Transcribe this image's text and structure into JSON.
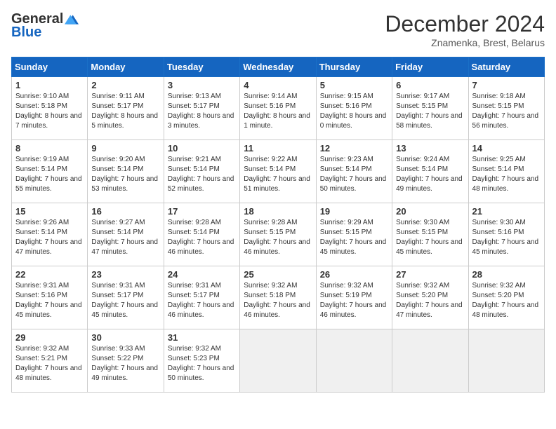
{
  "header": {
    "logo_general": "General",
    "logo_blue": "Blue",
    "month": "December 2024",
    "location": "Znamenka, Brest, Belarus"
  },
  "days_of_week": [
    "Sunday",
    "Monday",
    "Tuesday",
    "Wednesday",
    "Thursday",
    "Friday",
    "Saturday"
  ],
  "weeks": [
    [
      {
        "day": "1",
        "sunrise": "Sunrise: 9:10 AM",
        "sunset": "Sunset: 5:18 PM",
        "daylight": "Daylight: 8 hours and 7 minutes."
      },
      {
        "day": "2",
        "sunrise": "Sunrise: 9:11 AM",
        "sunset": "Sunset: 5:17 PM",
        "daylight": "Daylight: 8 hours and 5 minutes."
      },
      {
        "day": "3",
        "sunrise": "Sunrise: 9:13 AM",
        "sunset": "Sunset: 5:17 PM",
        "daylight": "Daylight: 8 hours and 3 minutes."
      },
      {
        "day": "4",
        "sunrise": "Sunrise: 9:14 AM",
        "sunset": "Sunset: 5:16 PM",
        "daylight": "Daylight: 8 hours and 1 minute."
      },
      {
        "day": "5",
        "sunrise": "Sunrise: 9:15 AM",
        "sunset": "Sunset: 5:16 PM",
        "daylight": "Daylight: 8 hours and 0 minutes."
      },
      {
        "day": "6",
        "sunrise": "Sunrise: 9:17 AM",
        "sunset": "Sunset: 5:15 PM",
        "daylight": "Daylight: 7 hours and 58 minutes."
      },
      {
        "day": "7",
        "sunrise": "Sunrise: 9:18 AM",
        "sunset": "Sunset: 5:15 PM",
        "daylight": "Daylight: 7 hours and 56 minutes."
      }
    ],
    [
      {
        "day": "8",
        "sunrise": "Sunrise: 9:19 AM",
        "sunset": "Sunset: 5:14 PM",
        "daylight": "Daylight: 7 hours and 55 minutes."
      },
      {
        "day": "9",
        "sunrise": "Sunrise: 9:20 AM",
        "sunset": "Sunset: 5:14 PM",
        "daylight": "Daylight: 7 hours and 53 minutes."
      },
      {
        "day": "10",
        "sunrise": "Sunrise: 9:21 AM",
        "sunset": "Sunset: 5:14 PM",
        "daylight": "Daylight: 7 hours and 52 minutes."
      },
      {
        "day": "11",
        "sunrise": "Sunrise: 9:22 AM",
        "sunset": "Sunset: 5:14 PM",
        "daylight": "Daylight: 7 hours and 51 minutes."
      },
      {
        "day": "12",
        "sunrise": "Sunrise: 9:23 AM",
        "sunset": "Sunset: 5:14 PM",
        "daylight": "Daylight: 7 hours and 50 minutes."
      },
      {
        "day": "13",
        "sunrise": "Sunrise: 9:24 AM",
        "sunset": "Sunset: 5:14 PM",
        "daylight": "Daylight: 7 hours and 49 minutes."
      },
      {
        "day": "14",
        "sunrise": "Sunrise: 9:25 AM",
        "sunset": "Sunset: 5:14 PM",
        "daylight": "Daylight: 7 hours and 48 minutes."
      }
    ],
    [
      {
        "day": "15",
        "sunrise": "Sunrise: 9:26 AM",
        "sunset": "Sunset: 5:14 PM",
        "daylight": "Daylight: 7 hours and 47 minutes."
      },
      {
        "day": "16",
        "sunrise": "Sunrise: 9:27 AM",
        "sunset": "Sunset: 5:14 PM",
        "daylight": "Daylight: 7 hours and 47 minutes."
      },
      {
        "day": "17",
        "sunrise": "Sunrise: 9:28 AM",
        "sunset": "Sunset: 5:14 PM",
        "daylight": "Daylight: 7 hours and 46 minutes."
      },
      {
        "day": "18",
        "sunrise": "Sunrise: 9:28 AM",
        "sunset": "Sunset: 5:15 PM",
        "daylight": "Daylight: 7 hours and 46 minutes."
      },
      {
        "day": "19",
        "sunrise": "Sunrise: 9:29 AM",
        "sunset": "Sunset: 5:15 PM",
        "daylight": "Daylight: 7 hours and 45 minutes."
      },
      {
        "day": "20",
        "sunrise": "Sunrise: 9:30 AM",
        "sunset": "Sunset: 5:15 PM",
        "daylight": "Daylight: 7 hours and 45 minutes."
      },
      {
        "day": "21",
        "sunrise": "Sunrise: 9:30 AM",
        "sunset": "Sunset: 5:16 PM",
        "daylight": "Daylight: 7 hours and 45 minutes."
      }
    ],
    [
      {
        "day": "22",
        "sunrise": "Sunrise: 9:31 AM",
        "sunset": "Sunset: 5:16 PM",
        "daylight": "Daylight: 7 hours and 45 minutes."
      },
      {
        "day": "23",
        "sunrise": "Sunrise: 9:31 AM",
        "sunset": "Sunset: 5:17 PM",
        "daylight": "Daylight: 7 hours and 45 minutes."
      },
      {
        "day": "24",
        "sunrise": "Sunrise: 9:31 AM",
        "sunset": "Sunset: 5:17 PM",
        "daylight": "Daylight: 7 hours and 46 minutes."
      },
      {
        "day": "25",
        "sunrise": "Sunrise: 9:32 AM",
        "sunset": "Sunset: 5:18 PM",
        "daylight": "Daylight: 7 hours and 46 minutes."
      },
      {
        "day": "26",
        "sunrise": "Sunrise: 9:32 AM",
        "sunset": "Sunset: 5:19 PM",
        "daylight": "Daylight: 7 hours and 46 minutes."
      },
      {
        "day": "27",
        "sunrise": "Sunrise: 9:32 AM",
        "sunset": "Sunset: 5:20 PM",
        "daylight": "Daylight: 7 hours and 47 minutes."
      },
      {
        "day": "28",
        "sunrise": "Sunrise: 9:32 AM",
        "sunset": "Sunset: 5:20 PM",
        "daylight": "Daylight: 7 hours and 48 minutes."
      }
    ],
    [
      {
        "day": "29",
        "sunrise": "Sunrise: 9:32 AM",
        "sunset": "Sunset: 5:21 PM",
        "daylight": "Daylight: 7 hours and 48 minutes."
      },
      {
        "day": "30",
        "sunrise": "Sunrise: 9:33 AM",
        "sunset": "Sunset: 5:22 PM",
        "daylight": "Daylight: 7 hours and 49 minutes."
      },
      {
        "day": "31",
        "sunrise": "Sunrise: 9:32 AM",
        "sunset": "Sunset: 5:23 PM",
        "daylight": "Daylight: 7 hours and 50 minutes."
      },
      null,
      null,
      null,
      null
    ]
  ]
}
